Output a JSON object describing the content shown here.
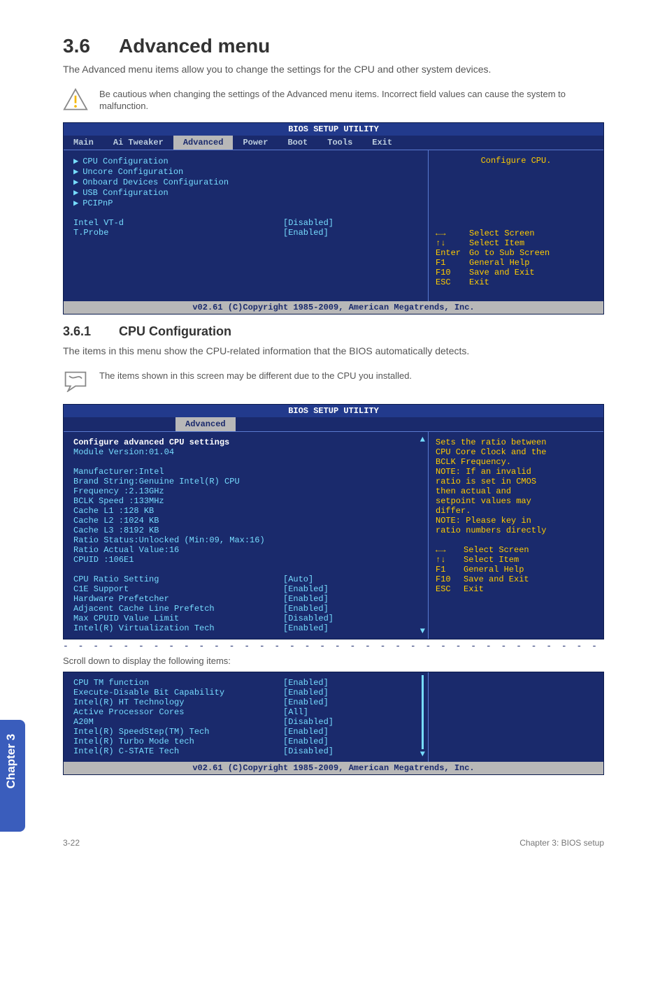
{
  "heading": {
    "num": "3.6",
    "title": "Advanced menu"
  },
  "intro": "The Advanced menu items allow you to change the settings for the CPU and other system devices.",
  "note1": "Be cautious when changing the settings of the Advanced menu items. Incorrect field values can cause the system to malfunction.",
  "bios1": {
    "title": "BIOS SETUP UTILITY",
    "tabs": [
      "Main",
      "Ai Tweaker",
      "Advanced",
      "Power",
      "Boot",
      "Tools",
      "Exit"
    ],
    "active_tab": "Advanced",
    "menu_items": [
      "CPU Configuration",
      "Uncore Configuration",
      "Onboard Devices Configuration",
      "USB Configuration",
      "PCIPnP"
    ],
    "settings": [
      {
        "k": "Intel VT-d",
        "v": "[Disabled]"
      },
      {
        "k": "T.Probe",
        "v": "[Enabled]"
      }
    ],
    "help_top": "Configure CPU.",
    "legend": [
      {
        "k": "←→",
        "v": "Select Screen"
      },
      {
        "k": "↑↓",
        "v": "Select Item"
      },
      {
        "k": "Enter",
        "v": "Go to Sub Screen"
      },
      {
        "k": "F1",
        "v": "General Help"
      },
      {
        "k": "F10",
        "v": "Save and Exit"
      },
      {
        "k": "ESC",
        "v": "Exit"
      }
    ],
    "footer": "v02.61 (C)Copyright 1985-2009, American Megatrends, Inc."
  },
  "sub": {
    "num": "3.6.1",
    "title": "CPU Configuration"
  },
  "sub_intro": "The items in this menu show the CPU-related information that the BIOS automatically detects.",
  "note2": "The items shown in this screen may be different due to the CPU you installed.",
  "bios2": {
    "title": "BIOS SETUP UTILITY",
    "active_tab": "Advanced",
    "header": "Configure advanced CPU settings",
    "module": "Module Version:01.04",
    "info": [
      "Manufacturer:Intel",
      "Brand String:Genuine Intel(R) CPU",
      "Frequency   :2.13GHz",
      "BCLK Speed  :133MHz",
      "Cache L1    :128 KB",
      "Cache L2    :1024 KB",
      "Cache L3    :8192 KB",
      "Ratio Status:Unlocked (Min:09, Max:16)",
      "Ratio Actual Value:16",
      "CPUID       :106E1"
    ],
    "settings": [
      {
        "k": "CPU Ratio Setting",
        "v": "[Auto]"
      },
      {
        "k": "C1E Support",
        "v": "[Enabled]"
      },
      {
        "k": "Hardware Prefetcher",
        "v": "[Enabled]"
      },
      {
        "k": "Adjacent Cache Line Prefetch",
        "v": "[Enabled]"
      },
      {
        "k": "Max CPUID Value Limit",
        "v": "[Disabled]"
      },
      {
        "k": "Intel(R) Virtualization Tech",
        "v": "[Enabled]"
      }
    ],
    "help": [
      "Sets the ratio between",
      "CPU Core Clock and the",
      "BCLK Frequency.",
      "NOTE: If an invalid",
      "ratio is set in CMOS",
      "then actual and",
      "setpoint values may",
      "differ.",
      "",
      "NOTE: Please key in",
      "ratio numbers directly"
    ],
    "legend": [
      {
        "k": "←→",
        "v": "Select Screen"
      },
      {
        "k": "↑↓",
        "v": "Select Item"
      },
      {
        "k": "F1",
        "v": "General Help"
      },
      {
        "k": "F10",
        "v": "Save and Exit"
      },
      {
        "k": "ESC",
        "v": "Exit"
      }
    ]
  },
  "scroll_text": "Scroll down to display the following items:",
  "bios3": {
    "settings": [
      {
        "k": "CPU TM function",
        "v": "[Enabled]"
      },
      {
        "k": "Execute-Disable Bit Capability",
        "v": "[Enabled]"
      },
      {
        "k": "Intel(R) HT Technology",
        "v": "[Enabled]"
      },
      {
        "k": "Active Processor Cores",
        "v": "[All]"
      },
      {
        "k": "A20M",
        "v": "[Disabled]"
      },
      {
        "k": "Intel(R) SpeedStep(TM) Tech",
        "v": "[Enabled]"
      },
      {
        "k": "Intel(R) Turbo Mode tech",
        "v": "[Enabled]"
      },
      {
        "k": "Intel(R) C-STATE Tech",
        "v": "[Disabled]"
      }
    ],
    "footer": "v02.61 (C)Copyright 1985-2009, American Megatrends, Inc."
  },
  "sidetab": "Chapter 3",
  "pagefoot": {
    "left": "3-22",
    "right": "Chapter 3: BIOS setup"
  }
}
